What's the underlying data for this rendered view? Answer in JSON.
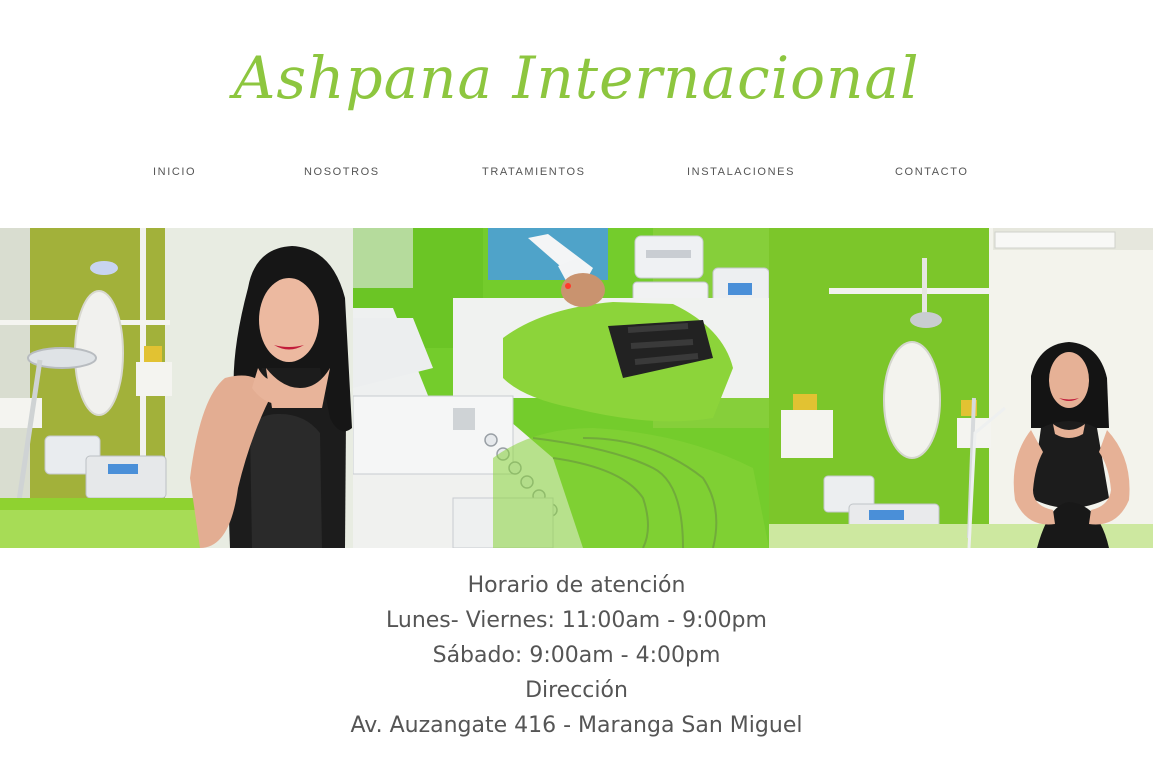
{
  "brand": {
    "name": "Ashpana Internacional",
    "color": "#8dc63f"
  },
  "nav": {
    "items": [
      {
        "label": "INICIO"
      },
      {
        "label": "NOSOTROS"
      },
      {
        "label": "TRATAMIENTOS"
      },
      {
        "label": "INSTALACIONES"
      },
      {
        "label": "CONTACTO"
      }
    ]
  },
  "gallery": {
    "accent": "#8cc63e",
    "photos": [
      {
        "subject": "woman-portrait-in-spa-room"
      },
      {
        "subject": "client-receiving-electrostimulation-treatment"
      },
      {
        "subject": "woman-posing-in-green-treatment-room"
      }
    ]
  },
  "info": {
    "text_color": "#555555",
    "lines": [
      "Horario de atención",
      "Lunes- Viernes: 11:00am - 9:00pm",
      "Sábado: 9:00am - 4:00pm",
      "Dirección",
      "Av. Auzangate 416 - Maranga San Miguel"
    ]
  }
}
